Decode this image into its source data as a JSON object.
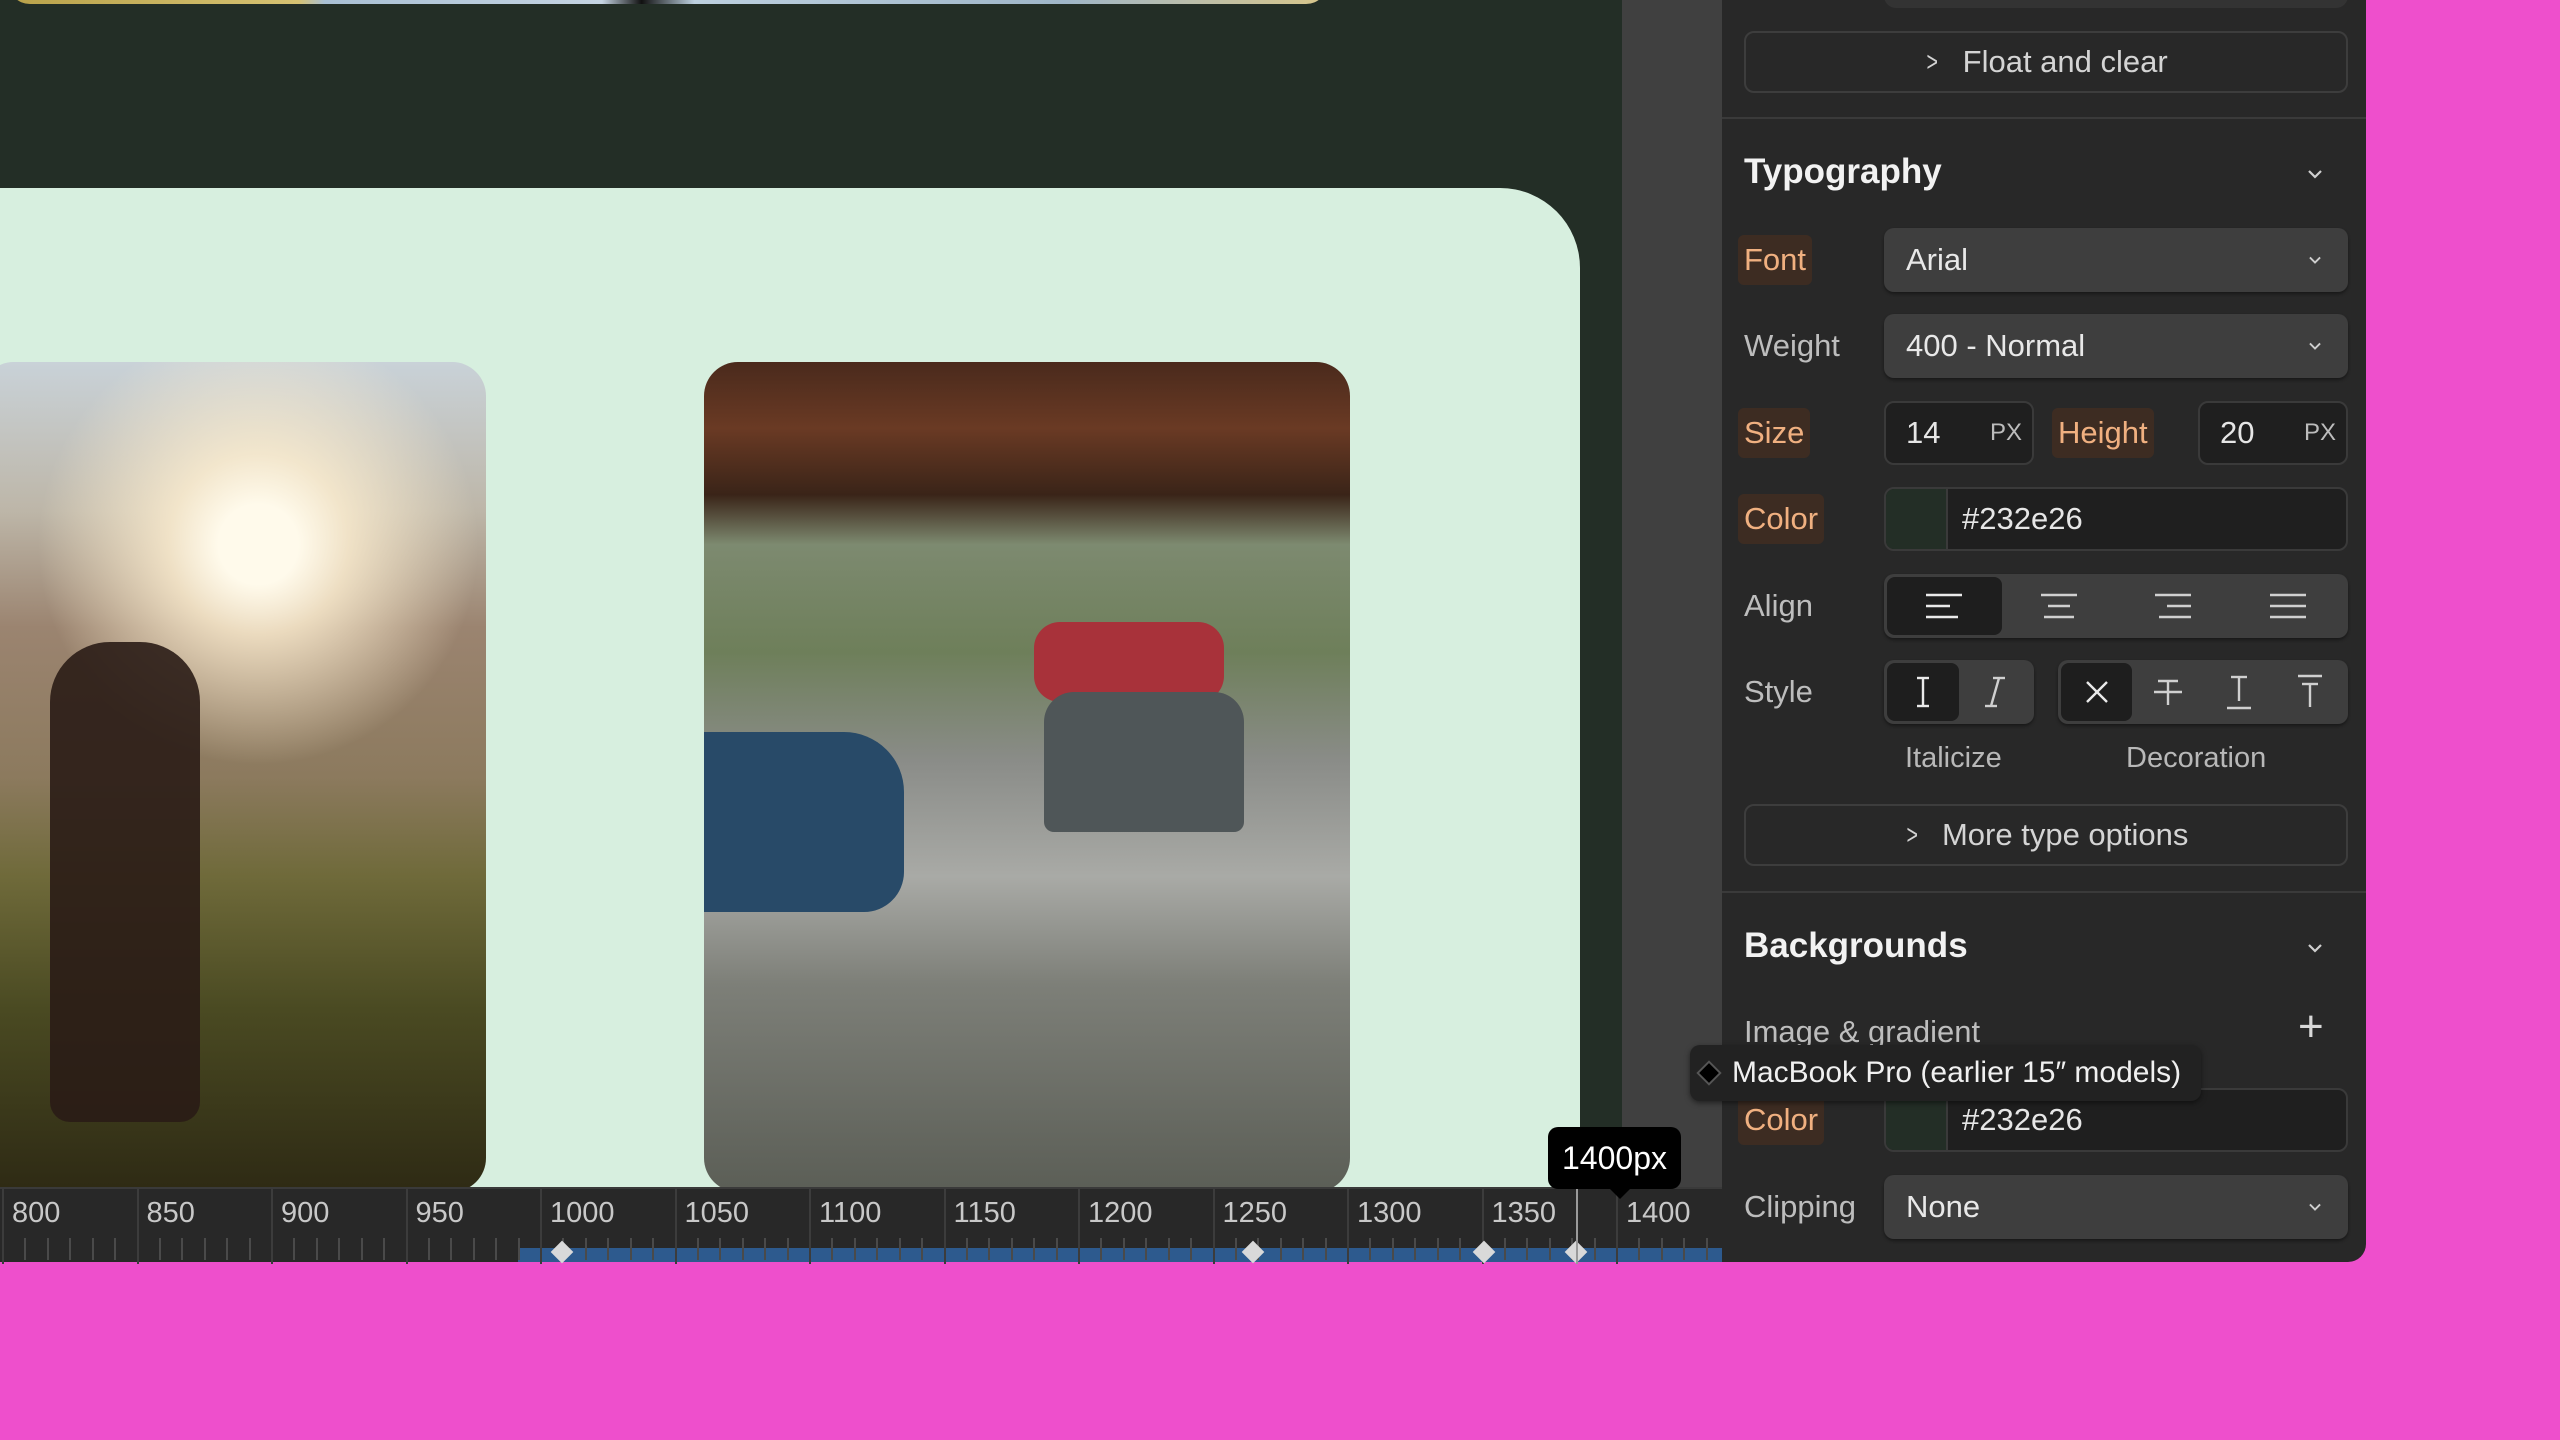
{
  "canvas": {
    "background_color": "#232e26",
    "card_color": "#d7efdf",
    "images": [
      {
        "name": "hiker-in-sunlit-field"
      },
      {
        "name": "backpacks-on-rocks"
      }
    ]
  },
  "panel": {
    "float_and_clear_label": "Float and clear",
    "typography": {
      "title": "Typography",
      "font_label": "Font",
      "font_value": "Arial",
      "weight_label": "Weight",
      "weight_value": "400 - Normal",
      "size_label": "Size",
      "size_value": "14",
      "size_unit": "PX",
      "height_label": "Height",
      "height_value": "20",
      "height_unit": "PX",
      "color_label": "Color",
      "color_value": "#232e26",
      "align_label": "Align",
      "align_options": [
        "left",
        "center",
        "right",
        "justify"
      ],
      "align_selected": "left",
      "style_label": "Style",
      "italicize_caption": "Italicize",
      "decoration_caption": "Decoration",
      "italic_options": [
        "regular",
        "italic"
      ],
      "italic_selected": "regular",
      "decoration_options": [
        "none",
        "strikethrough",
        "underline",
        "overline"
      ],
      "decoration_selected": "none",
      "more_options_label": "More type options"
    },
    "backgrounds": {
      "title": "Backgrounds",
      "image_gradient_label": "Image & gradient",
      "color_label": "Color",
      "color_value": "#232e26",
      "clipping_label": "Clipping",
      "clipping_value": "None"
    }
  },
  "tooltips": {
    "device_preset": "MacBook Pro (earlier 15″ models)",
    "width_readout": "1400px"
  },
  "ruler": {
    "labels": [
      "800",
      "850",
      "900",
      "950",
      "1000",
      "1050",
      "1100",
      "1150",
      "1200",
      "1250",
      "1300",
      "1350",
      "1400"
    ],
    "breakpoint_handles": [
      1008,
      1265,
      1351,
      1385
    ],
    "current_width": 1400,
    "accent_color": "#2d5a8e"
  },
  "colors": {
    "label_highlight": "#f0b080",
    "page_background": "#ee4fcc"
  }
}
